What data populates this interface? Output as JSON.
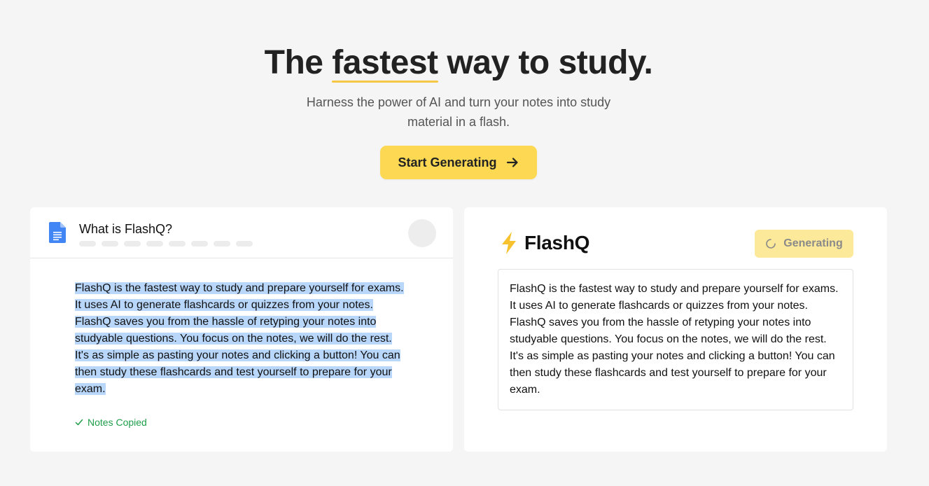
{
  "hero": {
    "title_prefix": "The ",
    "title_highlight": "fastest",
    "title_suffix": " way to study.",
    "subtitle": "Harness the power of AI and turn your notes into study material in a flash.",
    "cta_label": "Start Generating"
  },
  "doc": {
    "title": "What is FlashQ?",
    "body": "FlashQ is the fastest way to study and prepare yourself for exams. It uses AI to generate flashcards or quizzes from your notes. FlashQ saves you from the hassle of retyping your notes into studyable questions. You focus on the notes, we will do the rest. It's as simple as pasting your notes and clicking a button! You can then study these flashcards and test yourself to prepare for your exam.",
    "status": "Notes Copied"
  },
  "app": {
    "brand": "FlashQ",
    "generate_label": "Generating",
    "output": "FlashQ is the fastest way to study and prepare yourself for exams. It uses AI to generate flashcards or quizzes from your notes. FlashQ saves you from the hassle of retyping your notes into studyable questions. You focus on the notes, we will do the rest. It's as simple as pasting your notes and clicking a button! You can then study these flashcards and test yourself to prepare for your exam."
  },
  "colors": {
    "accent": "#fcd853",
    "selection": "#b8d7fb",
    "success": "#1f9d4a"
  },
  "icons": [
    "google-doc-icon",
    "arrow-right-icon",
    "lightning-icon",
    "spinner-icon",
    "check-icon"
  ]
}
